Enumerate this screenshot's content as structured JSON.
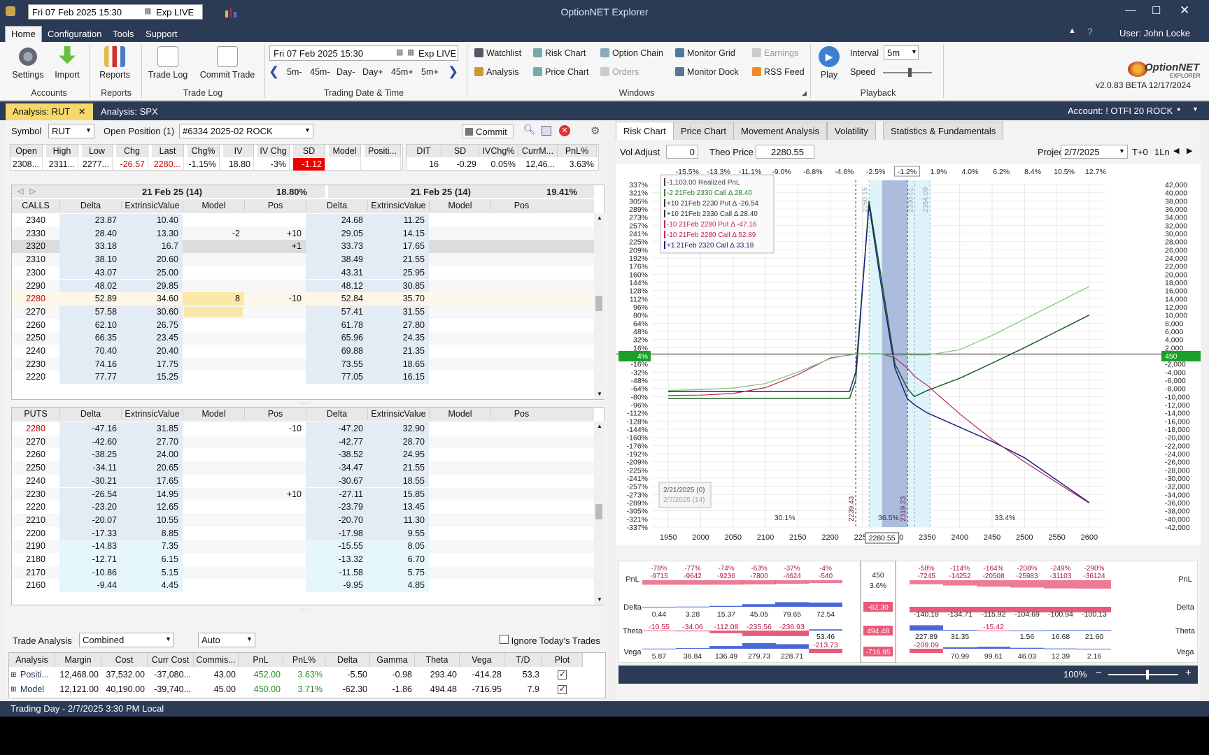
{
  "window": {
    "title": "OptionNET Explorer",
    "date_field": "Fri 07 Feb 2025 15:30",
    "exp_label": "Exp LIVE",
    "user": "User: John Locke"
  },
  "menu": [
    "Home",
    "Configuration",
    "Tools",
    "Support"
  ],
  "ribbon": {
    "accounts": {
      "settings": "Settings",
      "import": "Import",
      "label": "Accounts"
    },
    "reports": {
      "reports": "Reports",
      "label": "Reports"
    },
    "tradelog": {
      "trade_log": "Trade Log",
      "commit_trade": "Commit Trade",
      "label": "Trade Log"
    },
    "trading": {
      "date": "Fri 07 Feb 2025 15:30",
      "exp": "Exp LIVE",
      "steps": [
        "5m-",
        "45m-",
        "Day-",
        "Day+",
        "45m+",
        "5m+"
      ],
      "label": "Trading Date & Time"
    },
    "windows": {
      "watchlist": "Watchlist",
      "risk_chart": "Risk Chart",
      "option_chain": "Option Chain",
      "monitor_grid": "Monitor Grid",
      "earnings": "Earnings",
      "analysis": "Analysis",
      "price_chart": "Price Chart",
      "orders": "Orders",
      "monitor_dock": "Monitor Dock",
      "rss_feed": "RSS Feed",
      "label": "Windows"
    },
    "playback": {
      "play": "Play",
      "interval_label": "Interval",
      "interval": "5m",
      "speed_label": "Speed",
      "label": "Playback"
    },
    "version": "v2.0.83 BETA 12/17/2024",
    "logo": "OptionNET",
    "logo_sub": "EXPLORER"
  },
  "doc_tabs": {
    "tab1": "Analysis: RUT",
    "tab2": "Analysis: SPX",
    "account": "Account: ! OTFI 20 ROCK"
  },
  "left": {
    "symbol_label": "Symbol",
    "symbol": "RUT",
    "open_pos_label": "Open Position (1)",
    "position": "#6334 2025-02 ROCK",
    "commit": "Commit",
    "quote_headers": [
      "Open",
      "High",
      "Low",
      "Chg",
      "Last",
      "Chg%",
      "IV",
      "IV Chg",
      "SD",
      "Model",
      "Positi..."
    ],
    "quote_values": [
      "2308...",
      "2311...",
      "2277...",
      "-26.57",
      "2280...",
      "-1.15%",
      "18.80",
      "-3%",
      "-1.12",
      "",
      ""
    ],
    "stat_headers": [
      "DIT",
      "SD",
      "IVChg%",
      "CurrM...",
      "PnL%"
    ],
    "stat_values": [
      "16",
      "-0.29",
      "0.05%",
      "12,46...",
      "3.63%"
    ],
    "exp_left": "21 Feb 25 (14)",
    "iv_left": "18.80%",
    "exp_right": "21 Feb 25 (14)",
    "iv_right": "19.41%",
    "col_headers": [
      "Delta",
      "ExtrinsicValue",
      "Model",
      "Pos"
    ],
    "calls_label": "CALLS",
    "puts_label": "PUTS",
    "calls": [
      [
        "2340",
        "23.87",
        "10.40",
        "",
        "",
        "24.68",
        "11.25"
      ],
      [
        "2330",
        "28.40",
        "13.30",
        "-2",
        "+10",
        "29.05",
        "14.15"
      ],
      [
        "2320",
        "33.18",
        "16.7",
        "",
        "+1",
        "33.73",
        "17.65"
      ],
      [
        "2310",
        "38.10",
        "20.60",
        "",
        "",
        "38.49",
        "21.55"
      ],
      [
        "2300",
        "43.07",
        "25.00",
        "",
        "",
        "43.31",
        "25.95"
      ],
      [
        "2290",
        "48.02",
        "29.85",
        "",
        "",
        "48.12",
        "30.85"
      ],
      [
        "2280",
        "52.89",
        "34.60",
        "8",
        "-10",
        "52.84",
        "35.70"
      ],
      [
        "2270",
        "57.58",
        "30.60",
        "",
        "",
        "57.41",
        "31.55"
      ],
      [
        "2260",
        "62.10",
        "26.75",
        "",
        "",
        "61.78",
        "27.80"
      ],
      [
        "2250",
        "66.35",
        "23.45",
        "",
        "",
        "65.96",
        "24.35"
      ],
      [
        "2240",
        "70.40",
        "20.40",
        "",
        "",
        "69.88",
        "21.35"
      ],
      [
        "2230",
        "74.16",
        "17.75",
        "",
        "",
        "73.55",
        "18.65"
      ],
      [
        "2220",
        "77.77",
        "15.25",
        "",
        "",
        "77.05",
        "16.15"
      ]
    ],
    "puts": [
      [
        "2280",
        "-47.16",
        "31.85",
        "",
        "-10",
        "-47.20",
        "32.90"
      ],
      [
        "2270",
        "-42.60",
        "27.70",
        "",
        "",
        "-42.77",
        "28.70"
      ],
      [
        "2260",
        "-38.25",
        "24.00",
        "",
        "",
        "-38.52",
        "24.95"
      ],
      [
        "2250",
        "-34.11",
        "20.65",
        "",
        "",
        "-34.47",
        "21.55"
      ],
      [
        "2240",
        "-30.21",
        "17.65",
        "",
        "",
        "-30.67",
        "18.55"
      ],
      [
        "2230",
        "-26.54",
        "14.95",
        "",
        "+10",
        "-27.11",
        "15.85"
      ],
      [
        "2220",
        "-23.20",
        "12.65",
        "",
        "",
        "-23.79",
        "13.45"
      ],
      [
        "2210",
        "-20.07",
        "10.55",
        "",
        "",
        "-20.70",
        "11.30"
      ],
      [
        "2200",
        "-17.33",
        "8.85",
        "",
        "",
        "-17.98",
        "9.55"
      ],
      [
        "2190",
        "-14.83",
        "7.35",
        "",
        "",
        "-15.55",
        "8.05"
      ],
      [
        "2180",
        "-12.71",
        "6.15",
        "",
        "",
        "-13.32",
        "6.70"
      ],
      [
        "2170",
        "-10.86",
        "5.15",
        "",
        "",
        "-11.58",
        "5.75"
      ],
      [
        "2160",
        "-9.44",
        "4.45",
        "",
        "",
        "-9.95",
        "4.85"
      ]
    ],
    "trade_analysis_label": "Trade Analysis",
    "ta_mode": "Combined",
    "ta_auto": "Auto",
    "ignore_today": "Ignore Today's Trades",
    "bottom_headers": [
      "Analysis",
      "Margin",
      "Cost",
      "Curr Cost",
      "Commis...",
      "PnL",
      "PnL%",
      "Delta",
      "Gamma",
      "Theta",
      "Vega",
      "T/D",
      "Plot"
    ],
    "bottom_rows": [
      [
        "Positi...",
        "12,468.00",
        "37,532.00",
        "-37,080...",
        "43.00",
        "452.00",
        "3.63%",
        "-5.50",
        "-0.98",
        "293.40",
        "-414.28",
        "53.3"
      ],
      [
        "Model",
        "12,121.00",
        "40,190.00",
        "-39,740...",
        "45.00",
        "450.00",
        "3.71%",
        "-62.30",
        "-1.86",
        "494.48",
        "-716.95",
        "7.9"
      ]
    ]
  },
  "right": {
    "tabs": [
      "Risk Chart",
      "Price Chart",
      "Movement Analysis",
      "Volatility",
      "Statistics & Fundamentals"
    ],
    "vol_adjust_label": "Vol Adjust",
    "vol_adjust": "0",
    "theo_label": "Theo Price",
    "theo": "2280.55",
    "projection_label": "Projection",
    "projection": "2/7/2025",
    "t0": "T+0",
    "ln": "1Ln",
    "legend": [
      {
        "text": "-1,103.00 Realized PnL",
        "color": "#444"
      },
      {
        "text": "-2 21Feb 2330 Call Δ  28.40",
        "color": "#2e7d32"
      },
      {
        "text": "+10 21Feb 2230 Put Δ  -26.54",
        "color": "#333"
      },
      {
        "text": "+10 21Feb 2330 Call Δ  28.40",
        "color": "#333"
      },
      {
        "text": "-10 21Feb 2280 Put Δ  -47.16",
        "color": "#c0245a"
      },
      {
        "text": "-10 21Feb 2280 Call Δ  52.89",
        "color": "#c0245a"
      },
      {
        "text": "+1 21Feb 2320 Call Δ  33.18",
        "color": "#1a237e"
      }
    ],
    "top_pct": [
      "-15.5%",
      "-13.3%",
      "-11.1%",
      "-9.0%",
      "-6.8%",
      "-4.6%",
      "-2.5%",
      "-1.2%",
      "1.9%",
      "4.0%",
      "6.2%",
      "8.4%",
      "10.5%",
      "12.7%"
    ],
    "left_pct": [
      "337%",
      "321%",
      "305%",
      "289%",
      "273%",
      "257%",
      "241%",
      "225%",
      "209%",
      "192%",
      "176%",
      "160%",
      "144%",
      "128%",
      "112%",
      "96%",
      "80%",
      "64%",
      "48%",
      "32%",
      "16%",
      "4%",
      "-16%",
      "-32%",
      "-48%",
      "-64%",
      "-80%",
      "-96%",
      "-112%",
      "-128%",
      "-144%",
      "-160%",
      "-176%",
      "-192%",
      "-209%",
      "-225%",
      "-241%",
      "-257%",
      "-273%",
      "-289%",
      "-305%",
      "-321%",
      "-337%"
    ],
    "right_pnl": [
      "42,000",
      "40,000",
      "38,000",
      "36,000",
      "34,000",
      "32,000",
      "30,000",
      "28,000",
      "26,000",
      "24,000",
      "22,000",
      "20,000",
      "18,000",
      "16,000",
      "14,000",
      "12,000",
      "10,000",
      "8,000",
      "6,000",
      "4,000",
      "2,000",
      "450",
      "-2,000",
      "-4,000",
      "-6,000",
      "-8,000",
      "-10,000",
      "-12,000",
      "-14,000",
      "-16,000",
      "-18,000",
      "-20,000",
      "-22,000",
      "-24,000",
      "-26,000",
      "-28,000",
      "-30,000",
      "-32,000",
      "-34,000",
      "-36,000",
      "-38,000",
      "-40,000",
      "-42,000"
    ],
    "x_ticks": [
      "1950",
      "2000",
      "2050",
      "2100",
      "2150",
      "2200",
      "2250",
      "2300",
      "2350",
      "2400",
      "2450",
      "2500",
      "2550",
      "2600"
    ],
    "cursor_x": "2280.55",
    "dates_box": [
      "2/21/2025 (0)",
      "2/7/2025 (14)"
    ],
    "prob": [
      "30.1%",
      "36.5%",
      "33.4%"
    ],
    "vlines": [
      "2239.43",
      "2319.23",
      "2260.15",
      "2330.61",
      "2354.09"
    ],
    "pnl_row": {
      "pct": [
        "-78%",
        "-77%",
        "-74%",
        "-63%",
        "-37%",
        "-4%",
        "",
        "-58%",
        "-114%",
        "-164%",
        "-208%",
        "-249%",
        "-290%"
      ],
      "val": [
        "-9715",
        "-9642",
        "-9236",
        "-7800",
        "-4624",
        "-540",
        "",
        "-7245",
        "-14252",
        "-20508",
        "-25983",
        "-31103",
        "-36124"
      ]
    },
    "delta_row": [
      "0.44",
      "3.28",
      "15.37",
      "45.05",
      "79.65",
      "72.54",
      "-140.18",
      "-134.71",
      "-115.92",
      "-104.69",
      "-100.94",
      "-100.13"
    ],
    "theta_row": [
      "-10.55",
      "-34.06",
      "-112.08",
      "-235.56",
      "-236.93",
      "53.46",
      "227.89",
      "31.35",
      "-15.42",
      "1.56",
      "16.68",
      "21.60"
    ],
    "vega_row": [
      "5.87",
      "36.84",
      "136.49",
      "279.73",
      "228.71",
      "-213.73",
      "-209.09",
      "70.99",
      "99.61",
      "46.03",
      "12.39",
      "2.16"
    ],
    "row_labels": [
      "PnL",
      "Delta",
      "Theta",
      "Vega"
    ],
    "cursor_box": [
      "450",
      "3.6%",
      "-62.30",
      "494.48",
      "-716.95"
    ],
    "zoom": "100%"
  },
  "status": "Trading Day - 2/7/2025 3:30 PM Local",
  "chart_data": {
    "type": "line",
    "x": [
      1950,
      2000,
      2050,
      2100,
      2150,
      2200,
      2230,
      2239.43,
      2260,
      2280,
      2300,
      2319.23,
      2330,
      2350,
      2400,
      2450,
      2500,
      2550,
      2600
    ],
    "series": [
      {
        "name": "",
        "values": [
          -10400,
          -10400,
          -10400,
          -10400,
          -10400,
          -10400,
          -10400,
          -6000,
          38000,
          18000,
          -2000,
          -8000,
          -10000,
          -8500,
          -5500,
          -1800,
          2000,
          6000,
          10000
        ]
      },
      {
        "name": "",
        "values": [
          -8800,
          -8700,
          -8700,
          -8700,
          -8700,
          -8700,
          -8700,
          -4000,
          37000,
          16000,
          -3000,
          -10500,
          -12000,
          -14000,
          -17500,
          -21000,
          -25000,
          -30500,
          -36000
        ]
      },
      {
        "name": "",
        "values": [
          -9715,
          -9642,
          -9236,
          -7800,
          -4624,
          -540,
          200,
          450,
          500,
          450,
          -500,
          -3000,
          -5000,
          -7245,
          -14252,
          -20508,
          -25983,
          -31103,
          -36124
        ]
      },
      {
        "name": "",
        "values": [
          -8500,
          -8300,
          -7900,
          -6800,
          -4000,
          -700,
          300,
          400,
          450,
          400,
          0,
          300,
          200,
          200,
          1500,
          5000,
          9000,
          13000,
          17000
        ]
      }
    ],
    "xlim": [
      1925,
      2625
    ],
    "ylim": [
      -42000,
      42000
    ]
  }
}
